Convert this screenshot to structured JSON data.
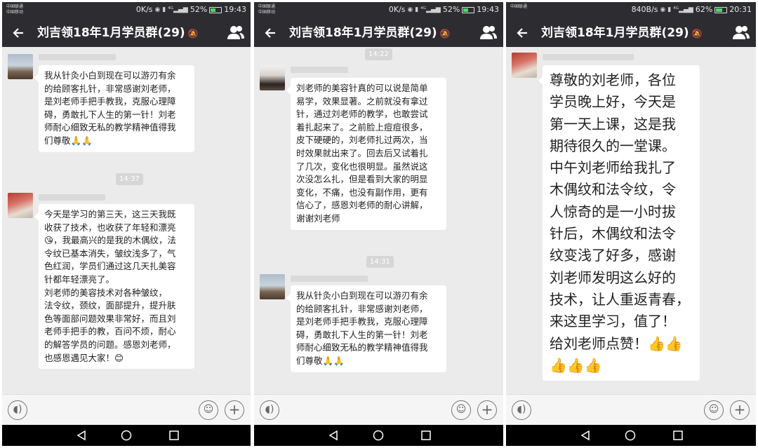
{
  "screens": [
    {
      "status": {
        "carrier1": "中国联通",
        "carrier2": "中国移动",
        "speed": "0K/s",
        "battery": "52%",
        "battery_level": 0.52,
        "time": "19:43"
      },
      "title": "刘吉领18年1月学员群(29)",
      "icons": {
        "back": "back-arrow-icon",
        "mute": "mute-bell-icon",
        "members": "group-members-icon"
      },
      "messages": [
        {
          "text": "我从针灸小白到现在可以游刃有余\n的给顾客扎针，非常感谢刘老师，\n是刘老师手把手教我，克服心理障\n碍，勇敢扎下人生的第一针！刘老\n师耐心细致无私的教学精神值得我\n们尊敬🙏🙏"
        },
        {
          "text": "今天是学习的第三天，这三天我既\n收获了技术，也收获了年轻和漂亮\n😘，我最高兴的是我的木偶纹，法\n令纹已基本消失，皱纹浅多了，气\n色红润，学员们通过这几天扎美容\n针都年轻漂亮了。\n    刘老师的美容技术对各种皱纹，\n法令纹，颈纹，面部提升，提升肤\n色等面部问题效果非常好，而且刘\n老师手把手的教，百问不烦，耐心\n的解答学员的问题。感恩刘老师，\n也感恩遇见大家！😊"
        }
      ],
      "times": [
        "14:37"
      ]
    },
    {
      "status": {
        "carrier1": "中国联通",
        "carrier2": "中国移动",
        "speed": "0K/s",
        "battery": "52%",
        "battery_level": 0.52,
        "time": "19:43"
      },
      "title": "刘吉领18年1月学员群(29)",
      "icons": {
        "back": "back-arrow-icon",
        "mute": "mute-bell-icon",
        "members": "group-members-icon"
      },
      "messages": [
        {
          "text": "刘老师的美容针真的可以说是简单\n易学，效果显著。之前就没有拿过\n针，通过刘老师的教学，也敢尝试\n着扎起来了。之前脸上痘痘很多，\n皮下硬硬的，刘老师扎过两次，当\n时效果就出来了。回去后又试着扎\n了几次，变化也很明显。虽然说这\n次没怎么扎，但是看到大家的明显\n变化，不痛，也没有副作用，更有\n信心了，感恩刘老师的耐心讲解，\n谢谢刘老师"
        },
        {
          "text": "我从针灸小白到现在可以游刃有余\n的给顾客扎针，非常感谢刘老师，\n是刘老师手把手教我，克服心理障\n碍，勇敢扎下人生的第一针！刘老\n师耐心细致无私的教学精神值得我\n们尊敬🙏🙏"
        }
      ],
      "times": [
        "14:22",
        "14:31"
      ]
    },
    {
      "status": {
        "carrier1": "中国联通",
        "carrier2": "",
        "speed": "840B/s",
        "battery": "62%",
        "battery_level": 0.62,
        "time": "20:31"
      },
      "title": "刘吉领18年1月学员群(29)",
      "icons": {
        "back": "back-arrow-icon",
        "mute": "mute-bell-icon",
        "members": "group-members-icon"
      },
      "messages": [
        {
          "text": "尊敬的刘老师，各位\n学员晚上好，今天是\n第一天上课，这是我\n期待很久的一堂课。\n中午刘老师给我扎了\n木偶纹和法令纹，令\n人惊奇的是一小时拔\n针后，木偶纹和法令\n纹变浅了好多，感谢\n刘老师发明这么好的\n技术，让人重返青春，\n来这里学习，值了！\n给刘老师点赞！👍👍\n👍👍👍"
        }
      ],
      "times": []
    }
  ],
  "input_icons": {
    "voice": "voice-icon",
    "emoji": "emoji-icon",
    "more": "plus-icon"
  },
  "nav_icons": [
    "back-triangle-icon",
    "home-circle-icon",
    "recents-square-icon"
  ],
  "colors": {
    "header": "#2d2d31",
    "chat_bg": "#ebebeb",
    "bubble": "#ffffff",
    "navbar": "#000000"
  }
}
